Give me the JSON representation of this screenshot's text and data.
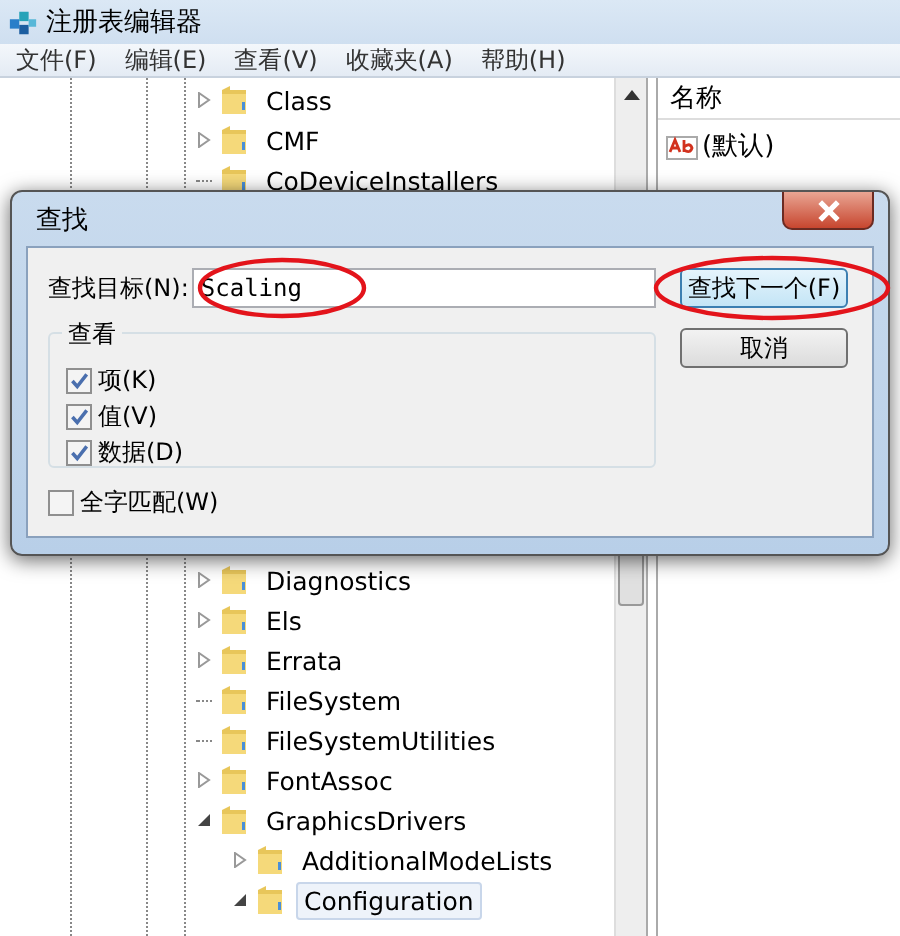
{
  "window": {
    "title": "注册表编辑器"
  },
  "menu": [
    "文件(F)",
    "编辑(E)",
    "查看(V)",
    "收藏夹(A)",
    "帮助(H)"
  ],
  "tree_above_dialog": [
    {
      "label": "Class",
      "kind": "collapsed",
      "selected": false
    },
    {
      "label": "CMF",
      "kind": "collapsed",
      "selected": false
    },
    {
      "label": "CoDeviceInstallers",
      "kind": "leaf",
      "selected": false
    }
  ],
  "tree_below_dialog": [
    {
      "label": "Diagnostics",
      "kind": "collapsed",
      "selected": false
    },
    {
      "label": "Els",
      "kind": "collapsed",
      "selected": false
    },
    {
      "label": "Errata",
      "kind": "collapsed",
      "selected": false
    },
    {
      "label": "FileSystem",
      "kind": "leaf",
      "selected": false
    },
    {
      "label": "FileSystemUtilities",
      "kind": "leaf",
      "selected": false
    },
    {
      "label": "FontAssoc",
      "kind": "collapsed",
      "selected": false
    },
    {
      "label": "GraphicsDrivers",
      "kind": "expanded",
      "selected": false,
      "children": [
        {
          "label": "AdditionalModeLists",
          "kind": "collapsed",
          "selected": false
        },
        {
          "label": "Configuration",
          "kind": "expanded",
          "selected": true
        }
      ]
    }
  ],
  "values_pane": {
    "column": "名称",
    "rows": [
      "(默认)"
    ]
  },
  "dialog": {
    "title": "查找",
    "find_label": "查找目标(N):",
    "find_value": "Scaling",
    "find_circled": true,
    "buttons": [
      {
        "label": "查找下一个(F)",
        "default": true,
        "circled": true
      },
      {
        "label": "取消",
        "default": false,
        "circled": false
      }
    ],
    "group": {
      "title": "查看",
      "options": [
        {
          "label": "项(K)",
          "checked": true
        },
        {
          "label": "值(V)",
          "checked": true
        },
        {
          "label": "数据(D)",
          "checked": true
        }
      ]
    },
    "whole_word": {
      "label": "全字匹配(W)",
      "checked": false
    }
  }
}
